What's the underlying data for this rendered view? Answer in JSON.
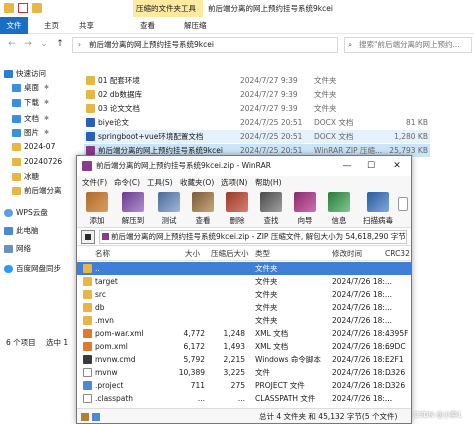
{
  "explorer": {
    "context_tab": "压缩的文件夹工具",
    "window_title": "前后端分离的网上预约挂号系统9kcei",
    "ribbon_tabs": [
      "文件",
      "主页",
      "共享",
      "查看",
      "解压缩"
    ],
    "address_path": "前后端分离的网上预约挂号系统9kcei",
    "search_placeholder": "搜索\"前后端分离的网上预约...",
    "nav_items": [
      {
        "label": "快速访问",
        "icon": "star-icon"
      },
      {
        "label": "桌面",
        "icon": "desktop-icon"
      },
      {
        "label": "下载",
        "icon": "download-icon"
      },
      {
        "label": "文档",
        "icon": "document-icon"
      },
      {
        "label": "图片",
        "icon": "picture-icon"
      },
      {
        "label": "2024-07",
        "icon": "folder-icon"
      },
      {
        "label": "20240726",
        "icon": "folder-icon"
      },
      {
        "label": "冰糖",
        "icon": "folder-icon"
      },
      {
        "label": "前后端分离",
        "icon": "folder-icon"
      },
      {
        "label": "WPS云盘",
        "icon": "cloud-icon"
      },
      {
        "label": "此电脑",
        "icon": "computer-icon"
      },
      {
        "label": "网络",
        "icon": "network-icon"
      },
      {
        "label": "百度网盘同步",
        "icon": "baidu-icon"
      }
    ],
    "files": [
      {
        "name": "01 配套环境",
        "date": "2024/7/27 9:39",
        "type": "文件夹",
        "size": ""
      },
      {
        "name": "02 db数据库",
        "date": "2024/7/27 9:39",
        "type": "文件夹",
        "size": ""
      },
      {
        "name": "03 论文文档",
        "date": "2024/7/27 9:39",
        "type": "文件夹",
        "size": ""
      },
      {
        "name": "biye论文",
        "date": "2024/7/25 20:51",
        "type": "DOCX 文档",
        "size": "81 KB"
      },
      {
        "name": "springboot+vue环境配置文档",
        "date": "2024/7/25 20:51",
        "type": "DOCX 文档",
        "size": "1,280 KB"
      },
      {
        "name": "前后端分离的网上预约挂号系统9kcei",
        "date": "2024/7/25 20:51",
        "type": "WinRAR ZIP 压缩...",
        "size": "25,793 KB"
      }
    ],
    "status_count": "6 个项目",
    "status_selected": "选中 1"
  },
  "winrar": {
    "title": "前后端分离的网上预约挂号系统9kcei.zip - WinRAR",
    "controls": {
      "minimize": "—",
      "maximize": "☐",
      "close": "✕"
    },
    "menu": [
      "文件(F)",
      "命令(C)",
      "工具(S)",
      "收藏夹(O)",
      "选项(N)",
      "帮助(H)"
    ],
    "toolbar": [
      {
        "label": "添加",
        "icon": "add-icon"
      },
      {
        "label": "解压到",
        "icon": "extract-icon"
      },
      {
        "label": "测试",
        "icon": "test-icon"
      },
      {
        "label": "查看",
        "icon": "view-icon"
      },
      {
        "label": "删除",
        "icon": "delete-icon"
      },
      {
        "label": "查找",
        "icon": "find-icon"
      },
      {
        "label": "向导",
        "icon": "wizard-icon"
      },
      {
        "label": "信息",
        "icon": "info-icon"
      },
      {
        "label": "扫描病毒",
        "icon": "virus-scan-icon"
      }
    ],
    "path_text": "前后端分离的网上预约挂号系统9kcei.zip - ZIP 压缩文件, 解包大小为 54,618,290 字节",
    "columns": [
      "名称",
      "大小",
      "压缩后大小",
      "类型",
      "修改时间",
      "CRC32"
    ],
    "rows": [
      {
        "name": "..",
        "size": "",
        "packed": "",
        "type": "文件夹",
        "modified": "",
        "crc": "",
        "icon": "folder-icon"
      },
      {
        "name": "target",
        "size": "",
        "packed": "",
        "type": "文件夹",
        "modified": "2024/7/26 18:...",
        "crc": "",
        "icon": "folder-icon"
      },
      {
        "name": "src",
        "size": "",
        "packed": "",
        "type": "文件夹",
        "modified": "2024/7/26 18:...",
        "crc": "",
        "icon": "folder-icon"
      },
      {
        "name": "db",
        "size": "",
        "packed": "",
        "type": "文件夹",
        "modified": "2024/7/26 18:...",
        "crc": "",
        "icon": "folder-icon"
      },
      {
        "name": ".mvn",
        "size": "",
        "packed": "",
        "type": "文件夹",
        "modified": "2024/7/26 18:...",
        "crc": "",
        "icon": "folder-icon"
      },
      {
        "name": "pom-war.xml",
        "size": "4,772",
        "packed": "1,248",
        "type": "XML 文档",
        "modified": "2024/7/26 18:...",
        "crc": "4395F",
        "icon": "xml-icon"
      },
      {
        "name": "pom.xml",
        "size": "6,172",
        "packed": "1,493",
        "type": "XML 文档",
        "modified": "2024/7/26 18:...",
        "crc": "69DC",
        "icon": "xml-icon"
      },
      {
        "name": "mvnw.cmd",
        "size": "5,792",
        "packed": "2,215",
        "type": "Windows 命令脚本",
        "modified": "2024/7/26 18:...",
        "crc": "E2F1",
        "icon": "cmd-icon"
      },
      {
        "name": "mvnw",
        "size": "10,389",
        "packed": "3,225",
        "type": "文件",
        "modified": "2024/7/26 18:...",
        "crc": "D326",
        "icon": "file-icon"
      },
      {
        "name": ".project",
        "size": "711",
        "packed": "275",
        "type": "PROJECT 文件",
        "modified": "2024/7/26 18:...",
        "crc": "D326",
        "icon": "project-icon"
      },
      {
        "name": ".classpath",
        "size": "...",
        "packed": "...",
        "type": "CLASSPATH 文件",
        "modified": "2024/7/26 18:...",
        "crc": "...",
        "icon": "file-icon"
      }
    ],
    "status_text": "总计 4 文件夹 和 45,132 字节(5 个文件)"
  },
  "watermark": "CSDN @小奔1"
}
